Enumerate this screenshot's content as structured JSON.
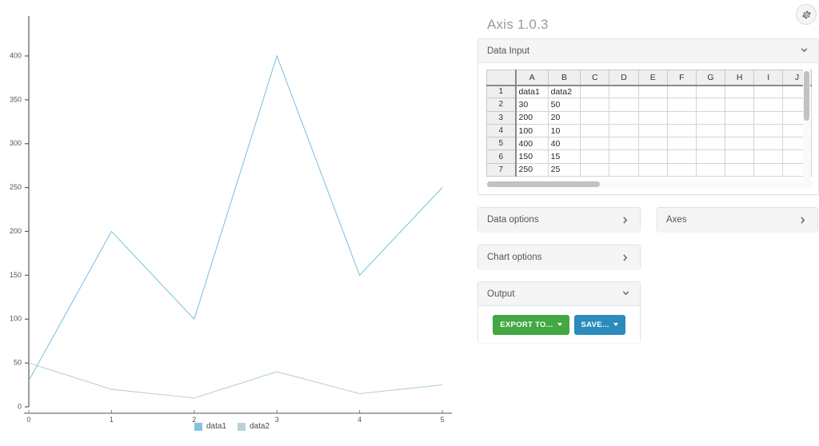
{
  "app": {
    "title": "Axis 1.0.3",
    "gear_icon": "gear-icon"
  },
  "panels": {
    "data_input": {
      "title": "Data Input",
      "chevron": "chevron-down-icon",
      "expanded": true
    },
    "data_options": {
      "title": "Data options",
      "chevron": "chevron-right-icon",
      "expanded": false
    },
    "axes": {
      "title": "Axes",
      "chevron": "chevron-right-icon",
      "expanded": false
    },
    "chart_options": {
      "title": "Chart options",
      "chevron": "chevron-right-icon",
      "expanded": false
    },
    "output": {
      "title": "Output",
      "chevron": "chevron-down-icon",
      "expanded": true
    }
  },
  "output": {
    "export_label": "EXPORT TO...",
    "save_label": "SAVE...",
    "export_color": "#43a843",
    "save_color": "#2b8bbd"
  },
  "spreadsheet": {
    "column_headers": [
      "A",
      "B",
      "C",
      "D",
      "E",
      "F",
      "G",
      "H",
      "I",
      "J"
    ],
    "row_headers": [
      "1",
      "2",
      "3",
      "4",
      "5",
      "6",
      "7"
    ],
    "rows": [
      [
        "data1",
        "data2",
        "",
        "",
        "",
        "",
        "",
        "",
        "",
        ""
      ],
      [
        "30",
        "50",
        "",
        "",
        "",
        "",
        "",
        "",
        "",
        ""
      ],
      [
        "200",
        "20",
        "",
        "",
        "",
        "",
        "",
        "",
        "",
        ""
      ],
      [
        "100",
        "10",
        "",
        "",
        "",
        "",
        "",
        "",
        "",
        ""
      ],
      [
        "400",
        "40",
        "",
        "",
        "",
        "",
        "",
        "",
        "",
        ""
      ],
      [
        "150",
        "15",
        "",
        "",
        "",
        "",
        "",
        "",
        "",
        ""
      ],
      [
        "250",
        "25",
        "",
        "",
        "",
        "",
        "",
        "",
        "",
        ""
      ]
    ]
  },
  "chart_data": {
    "type": "line",
    "title": "",
    "xlabel": "",
    "ylabel": "",
    "x": [
      0,
      1,
      2,
      3,
      4,
      5
    ],
    "xticks": [
      "0",
      "1",
      "2",
      "3",
      "4",
      "5"
    ],
    "yticks": [
      "0",
      "50",
      "100",
      "150",
      "200",
      "250",
      "300",
      "350",
      "400"
    ],
    "xlim": [
      0,
      5
    ],
    "ylim": [
      0,
      400
    ],
    "grid": false,
    "legend_position": "bottom",
    "series": [
      {
        "name": "data1",
        "color": "#82c4e0",
        "values": [
          30,
          200,
          100,
          400,
          150,
          250
        ]
      },
      {
        "name": "data2",
        "color": "#b4d2d8",
        "values": [
          50,
          20,
          10,
          40,
          15,
          25
        ]
      }
    ]
  }
}
